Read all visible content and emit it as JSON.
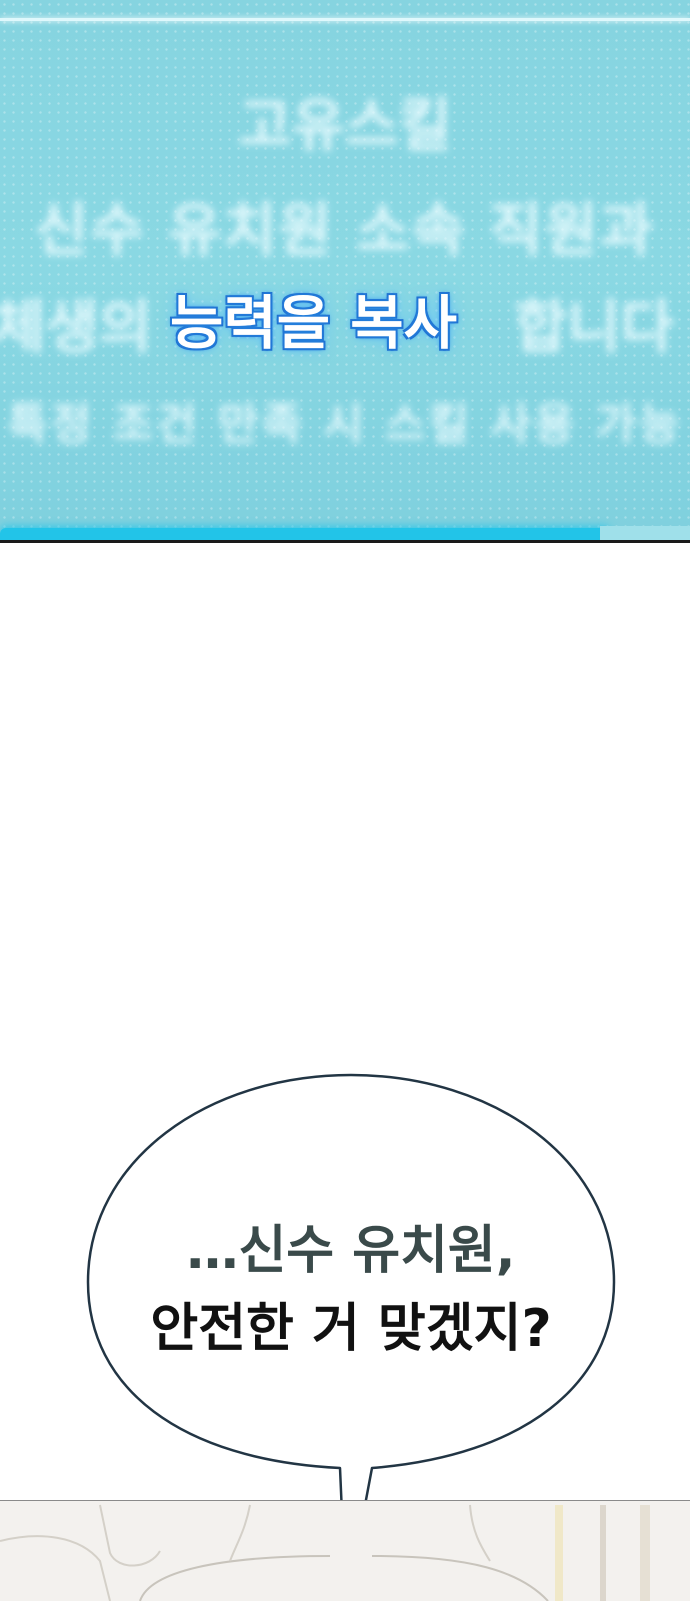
{
  "panel": {
    "line1": "고유스킬",
    "line2": "신수 유치원 소속 직원과",
    "line3_left": "체생의",
    "line3_highlight": "능력을 복사",
    "line3_right": "합니다",
    "line4": "특정 조건 만족 시 스킬 사용 가능"
  },
  "bubble": {
    "line1": "…신수 유치원,",
    "line2": "안전한 거 맞겠지?"
  },
  "colors": {
    "panel_bg": "#86d4e0",
    "highlight_glow": "#1f78d8",
    "bubble_stroke": "#223544"
  }
}
